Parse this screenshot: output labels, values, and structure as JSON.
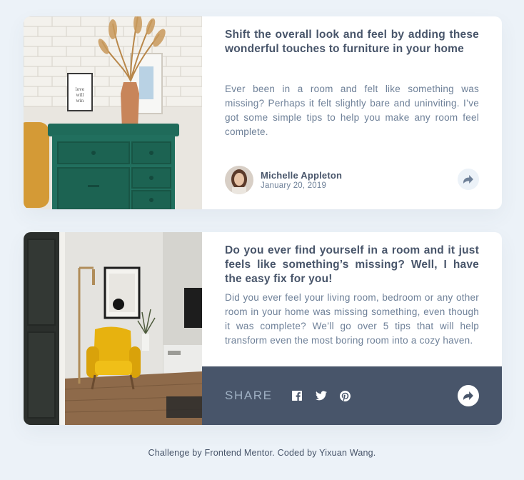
{
  "cards": [
    {
      "title": "Shift the overall look and feel by adding these wonderful touches to furniture in your home",
      "description": "Ever been in a room and felt like something was missing? Perhaps it felt slightly bare and uninviting. I’ve got some simple tips to help you make any room feel complete.",
      "author": {
        "name": "Michelle Appleton",
        "date": "January 20, 2019"
      },
      "share_icon": "share-arrow-icon"
    },
    {
      "title": "Do you ever find yourself in a room and it just feels like something’s missing? Well, I have the easy fix for you!",
      "description": "Did you ever feel your living room, bedroom or any other room in your home was missing something, even though it was complete? We’ll go over 5 tips that will help transform even the most boring room into a cozy haven.",
      "share_label": "SHARE",
      "social_icons": [
        "facebook-icon",
        "twitter-icon",
        "pinterest-icon"
      ],
      "share_icon": "share-arrow-icon"
    }
  ],
  "footer": {
    "prefix": "Challenge by ",
    "challenge_link": "Frontend Mentor",
    "middle": ". Coded by ",
    "author_link": "Yixuan Wang",
    "suffix": "."
  },
  "colors": {
    "background": "#ecf2f8",
    "card": "#ffffff",
    "dark": "#48556a",
    "muted": "#6e8098",
    "share_label": "#9eafc2"
  }
}
